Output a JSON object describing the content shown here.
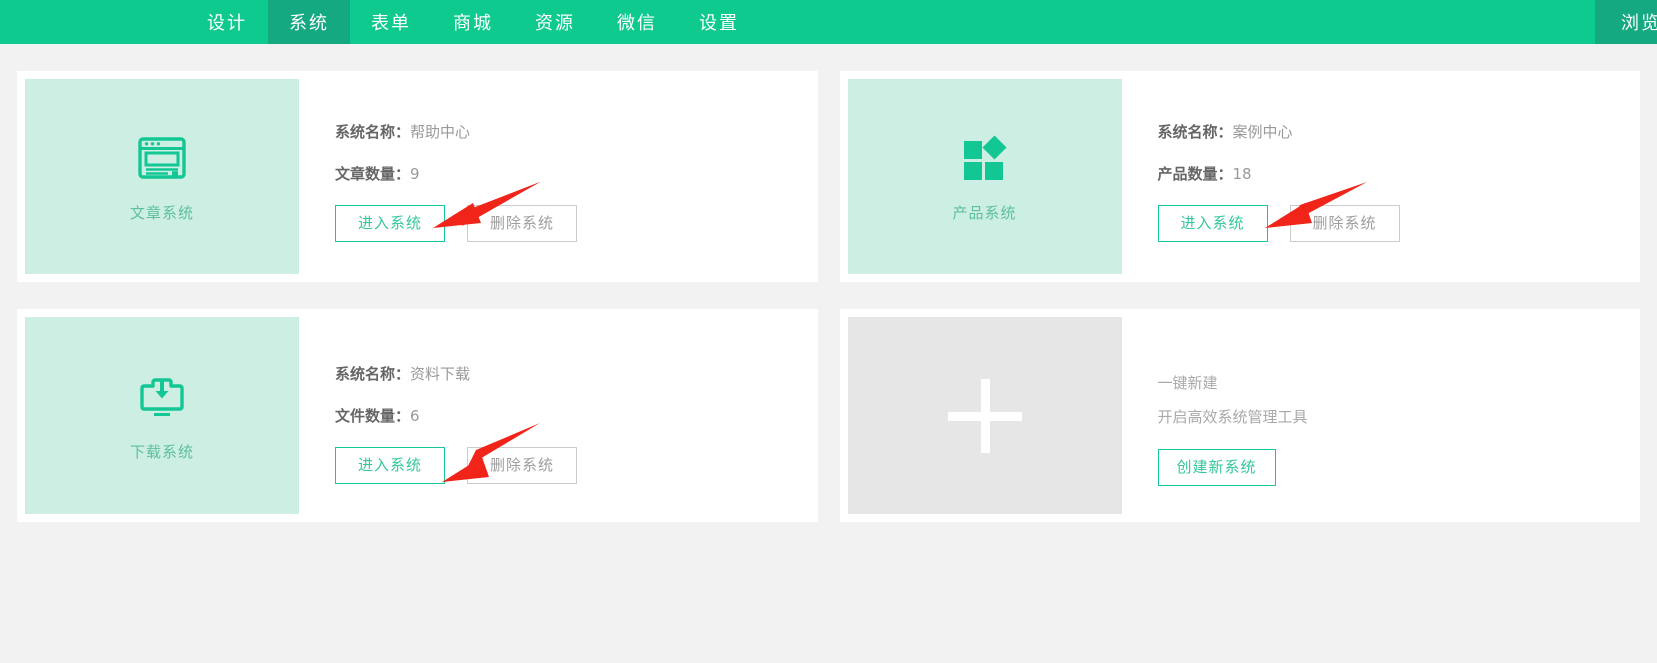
{
  "nav": {
    "items": [
      {
        "label": "设计",
        "active": false
      },
      {
        "label": "系统",
        "active": true
      },
      {
        "label": "表单",
        "active": false
      },
      {
        "label": "商城",
        "active": false
      },
      {
        "label": "资源",
        "active": false
      },
      {
        "label": "微信",
        "active": false
      },
      {
        "label": "设置",
        "active": false
      }
    ],
    "right_label": "浏览",
    "bar_color": "#0fca8e",
    "active_color": "#14a981"
  },
  "colors": {
    "page_background": "#f2f2f2",
    "card_background": "#ffffff",
    "thumb_mint": "#cdeee3",
    "thumb_gray": "#e6e6e6",
    "brand_green": "#16c79a",
    "arrow_red": "#f02418"
  },
  "cards": [
    {
      "thumb_label": "文章系统",
      "icon": "article-window-icon",
      "name_label": "系统名称：",
      "name_value": "帮助中心",
      "count_label": "文章数量：",
      "count_value": "9",
      "enter_button": "进入系统",
      "delete_button": "删除系统"
    },
    {
      "thumb_label": "产品系统",
      "icon": "product-squares-icon",
      "name_label": "系统名称：",
      "name_value": "案例中心",
      "count_label": "产品数量：",
      "count_value": "18",
      "enter_button": "进入系统",
      "delete_button": "删除系统"
    },
    {
      "thumb_label": "下载系统",
      "icon": "download-monitor-icon",
      "name_label": "系统名称：",
      "name_value": "资料下载",
      "count_label": "文件数量：",
      "count_value": "6",
      "enter_button": "进入系统",
      "delete_button": "删除系统"
    }
  ],
  "create_card": {
    "icon": "plus-icon",
    "title": "一键新建",
    "subtitle": "开启高效系统管理工具",
    "button": "创建新系统"
  }
}
